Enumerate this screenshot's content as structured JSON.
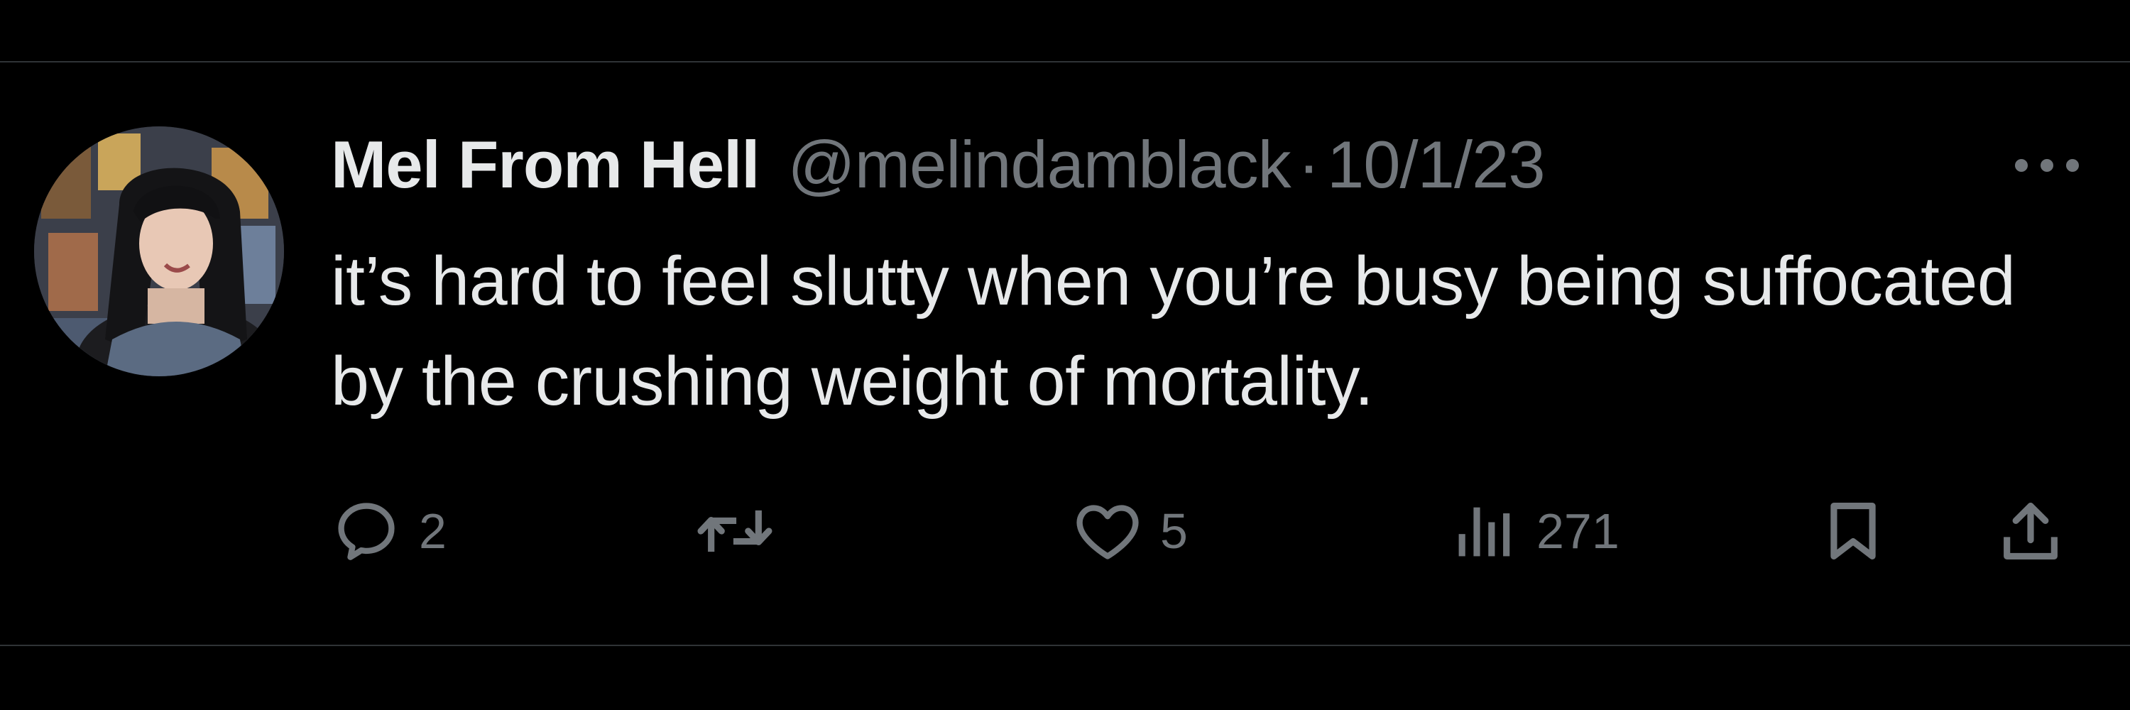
{
  "tweet": {
    "author": {
      "display_name": "Mel From Hell",
      "handle": "@melindamblack",
      "avatar_icon": "profile-photo"
    },
    "separator": "·",
    "date": "10/1/23",
    "text": "it’s hard to feel slutty when you’re busy being suffocated by the crushing weight of mortality.",
    "more_icon": "ellipsis-icon"
  },
  "actions": {
    "reply": {
      "icon": "speech-bubble-icon",
      "count": "2"
    },
    "retweet": {
      "icon": "retweet-arrows-icon",
      "count": ""
    },
    "like": {
      "icon": "heart-icon",
      "count": "5"
    },
    "views": {
      "icon": "bar-chart-icon",
      "count": "271"
    },
    "bookmark": {
      "icon": "bookmark-icon"
    },
    "share": {
      "icon": "share-upload-icon"
    }
  },
  "colors": {
    "background": "#000000",
    "primary_text": "#e7e9ea",
    "secondary_text": "#71767b",
    "divider": "#2f3336"
  }
}
